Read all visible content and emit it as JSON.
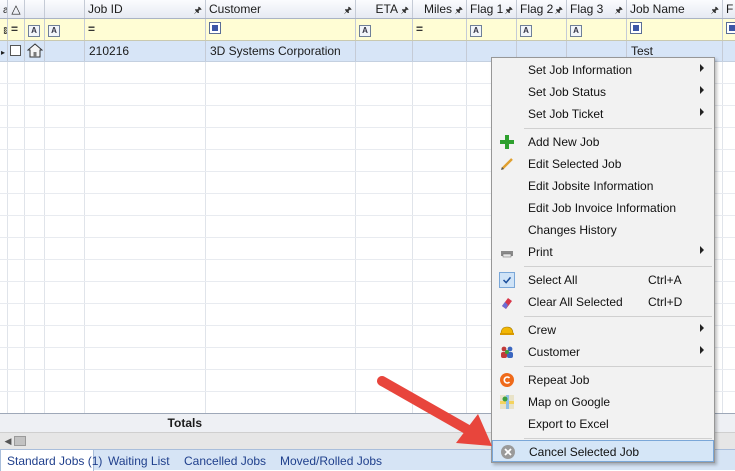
{
  "grid": {
    "headers": {
      "sort": "△",
      "job_id": "Job ID",
      "customer": "Customer",
      "eta": "ETA",
      "miles": "Miles",
      "flag1": "Flag 1",
      "flag2": "Flag 2",
      "flag3": "Flag 3",
      "job_name": "Job Name",
      "next": "F"
    },
    "filters": {
      "eq": "=",
      "a": "A"
    },
    "row": {
      "job_id": "210216",
      "customer": "3D Systems Corporation",
      "job_name": "Test"
    },
    "totals_label": "Totals"
  },
  "tabs": [
    {
      "label": "Standard Jobs (1)"
    },
    {
      "label": "Waiting List"
    },
    {
      "label": "Cancelled Jobs"
    },
    {
      "label": "Moved/Rolled Jobs"
    }
  ],
  "menu": {
    "set_job_information": "Set Job Information",
    "set_job_status": "Set Job Status",
    "set_job_ticket": "Set Job Ticket",
    "add_new_job": "Add New Job",
    "edit_selected_job": "Edit Selected Job",
    "edit_jobsite_information": "Edit Jobsite Information",
    "edit_job_invoice_information": "Edit Job Invoice Information",
    "changes_history": "Changes History",
    "print": "Print",
    "select_all": "Select All",
    "select_all_shortcut": "Ctrl+A",
    "clear_all_selected": "Clear All Selected",
    "clear_all_shortcut": "Ctrl+D",
    "crew": "Crew",
    "customer": "Customer",
    "repeat_job": "Repeat Job",
    "map_on_google": "Map on Google",
    "export_to_excel": "Export to Excel",
    "cancel_selected_job": "Cancel Selected Job"
  },
  "colors": {
    "arrow": "#e8453c",
    "highlight": "#d5e6f7",
    "tab_text": "#1f3f8c"
  }
}
